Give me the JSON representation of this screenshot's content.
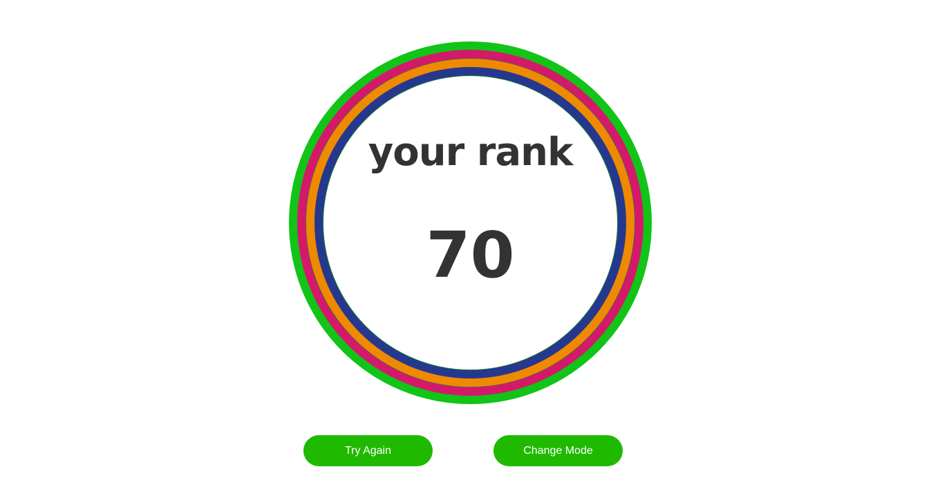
{
  "rank": {
    "label": "your rank",
    "value": "70"
  },
  "buttons": {
    "try_again": "Try Again",
    "change_mode": "Change Mode"
  },
  "colors": {
    "ring_outer": "#11c417",
    "ring_second": "#d4196a",
    "ring_third": "#ef8a00",
    "ring_fourth": "#26388e",
    "button": "#1fba00",
    "text": "#333333"
  }
}
